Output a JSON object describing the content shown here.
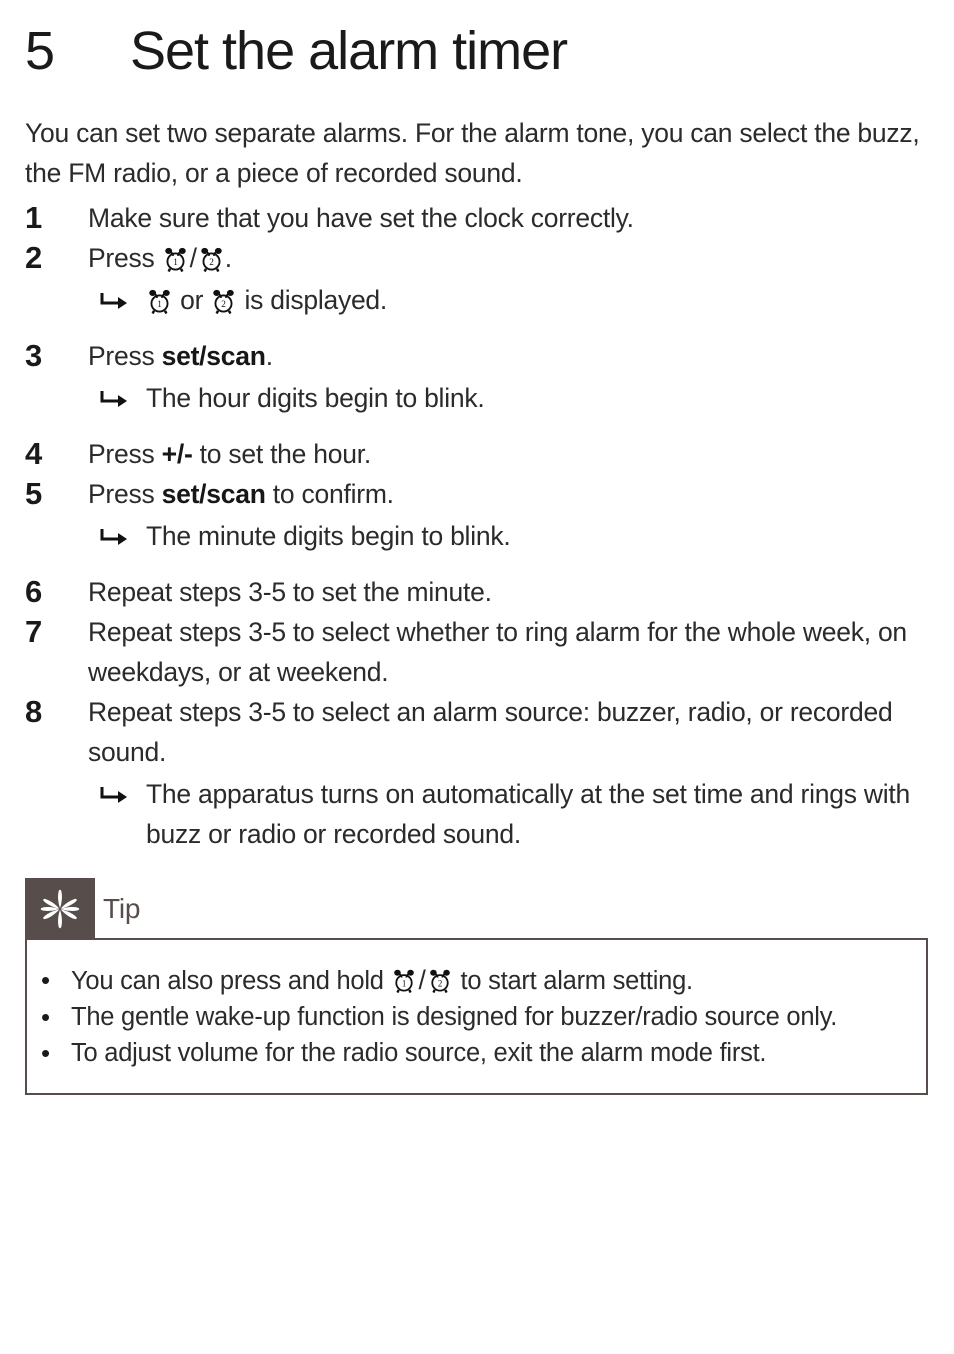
{
  "heading": {
    "number": "5",
    "title": "Set the alarm timer"
  },
  "intro": "You can set two separate alarms. For the alarm tone, you can select the buzz, the FM radio, or a piece of recorded sound.",
  "steps": [
    {
      "number": "1",
      "text": "Make sure that you have set the clock correctly."
    },
    {
      "number": "2",
      "text_before": "Press ",
      "icon1": "alarm-clock-1-icon",
      "separator": "/",
      "icon2": "alarm-clock-2-icon",
      "text_after": ".",
      "result_before": "",
      "result_icon1": "alarm-clock-1-icon",
      "result_mid": "or",
      "result_icon2": "alarm-clock-2-icon",
      "result_after": "is displayed."
    },
    {
      "number": "3",
      "text_before": "Press ",
      "bold": "set/scan",
      "text_after": ".",
      "result": "The hour digits begin to blink."
    },
    {
      "number": "4",
      "text_before": "Press ",
      "bold": "+/-",
      "text_after": " to set the hour."
    },
    {
      "number": "5",
      "text_before": "Press ",
      "bold": "set/scan",
      "text_after": " to confirm.",
      "result": "The minute digits begin to blink."
    },
    {
      "number": "6",
      "text": "Repeat steps 3-5 to set the minute."
    },
    {
      "number": "7",
      "text": "Repeat steps 3-5 to select whether to ring alarm for the whole week, on weekdays, or at weekend."
    },
    {
      "number": "8",
      "text": "Repeat steps 3-5 to select an alarm source: buzzer, radio, or recorded sound.",
      "result": "The apparatus turns on automatically at the set time and rings with buzz or radio or recorded sound."
    }
  ],
  "tip": {
    "label": "Tip",
    "icon": "asterisk-flower-icon",
    "badge_color": "#574E4C",
    "border_color": "#574E4C",
    "bullet_glyph": "•",
    "items": [
      {
        "text_before": "You can also press and hold ",
        "icon1": "alarm-clock-1-icon",
        "separator": "/",
        "icon2": "alarm-clock-2-icon",
        "text_after": " to start alarm setting."
      },
      {
        "text": "The gentle wake-up function is designed for buzzer/radio source only."
      },
      {
        "text": "To adjust volume for the radio source, exit the alarm mode first."
      }
    ]
  }
}
